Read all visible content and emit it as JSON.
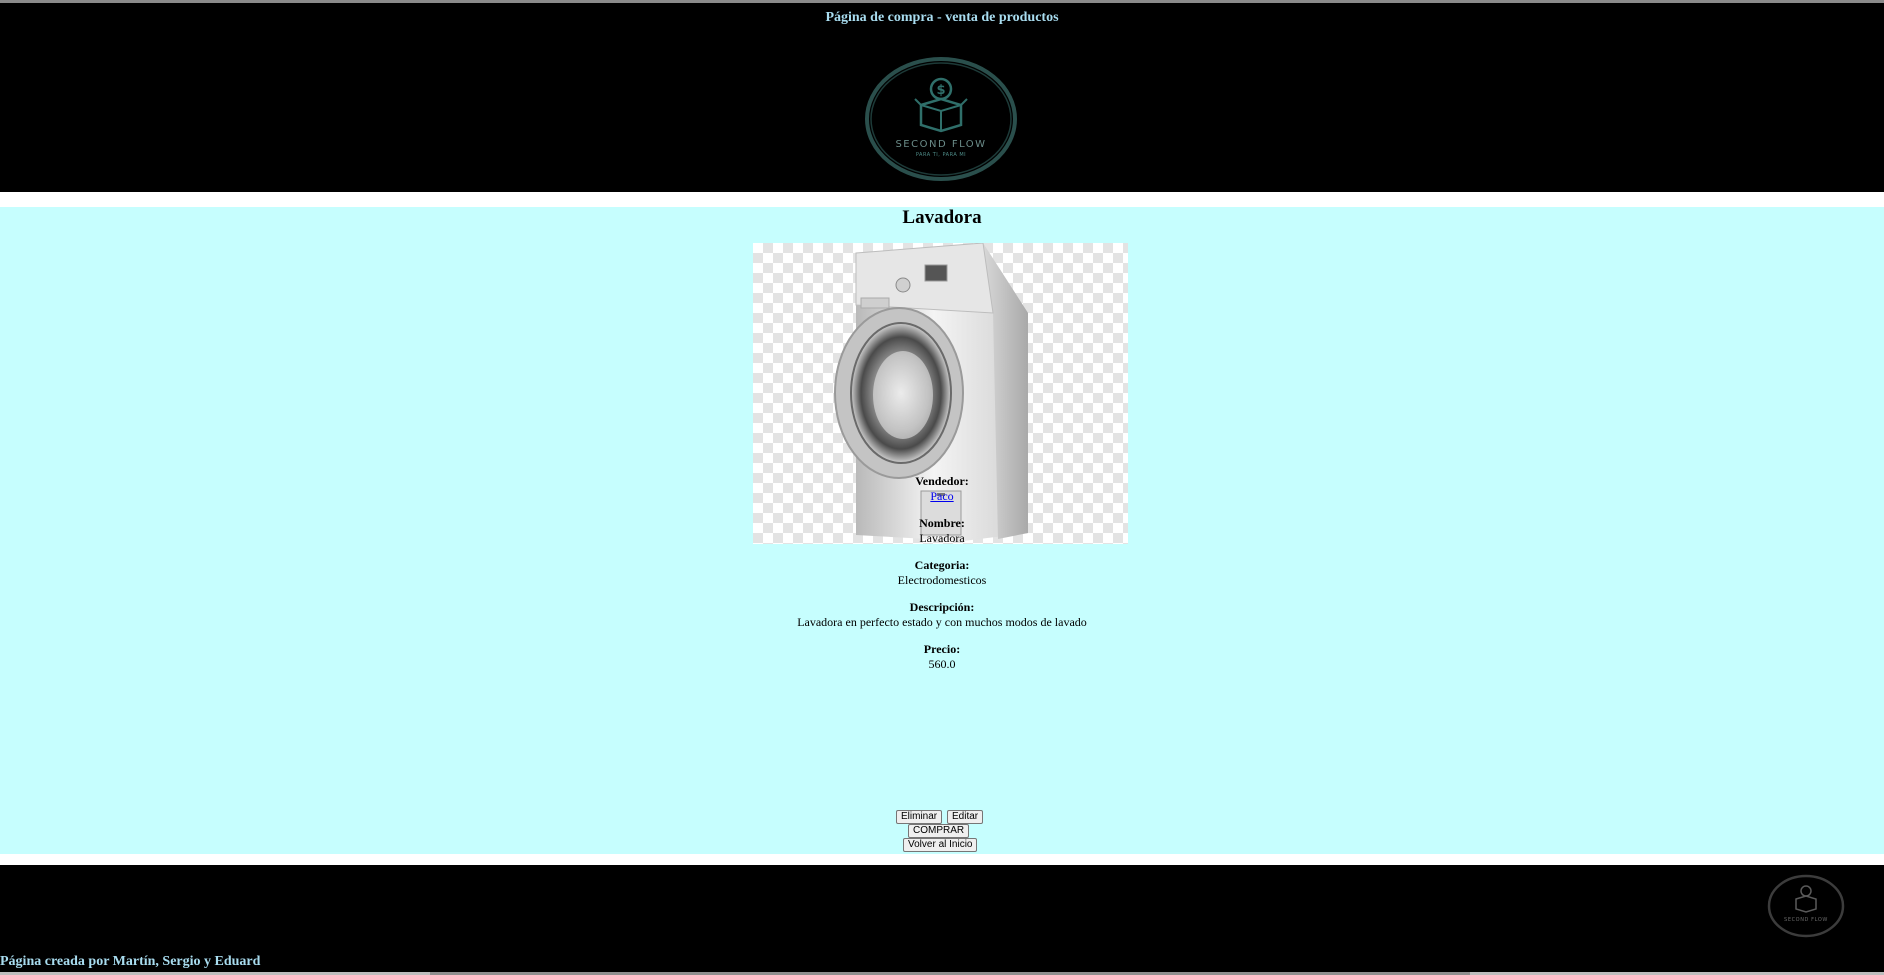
{
  "header": {
    "title": "Página de compra - venta de productos",
    "logo": {
      "icon": "second-flow-logo",
      "text": "SECOND FLOW",
      "tagline": "PARA TI, PARA MI"
    }
  },
  "product": {
    "title": "Lavadora",
    "image_icon": "washing-machine-image",
    "fields": {
      "seller_label": "Vendedor:",
      "seller_value": "Paco",
      "name_label": "Nombre:",
      "name_value": "Lavadora",
      "category_label": "Categoria:",
      "category_value": "Electrodomesticos",
      "description_label": "Descripción:",
      "description_value": "Lavadora en perfecto estado y con muchos modos de lavado",
      "price_label": "Precio:",
      "price_value": "560.0"
    }
  },
  "actions": {
    "delete_label": "Eliminar",
    "edit_label": "Editar",
    "buy_label": "COMPRAR",
    "home_label": "Volver al Inicio"
  },
  "footer": {
    "credit": "Página creada por Martín, Sergio y Eduard",
    "logo": {
      "icon": "second-flow-logo",
      "text": "SECOND FLOW"
    }
  },
  "colors": {
    "header_bg": "#000000",
    "content_bg": "#c6fefe",
    "header_text": "#a8dcef",
    "logo_teal": "#2f6f6a"
  }
}
